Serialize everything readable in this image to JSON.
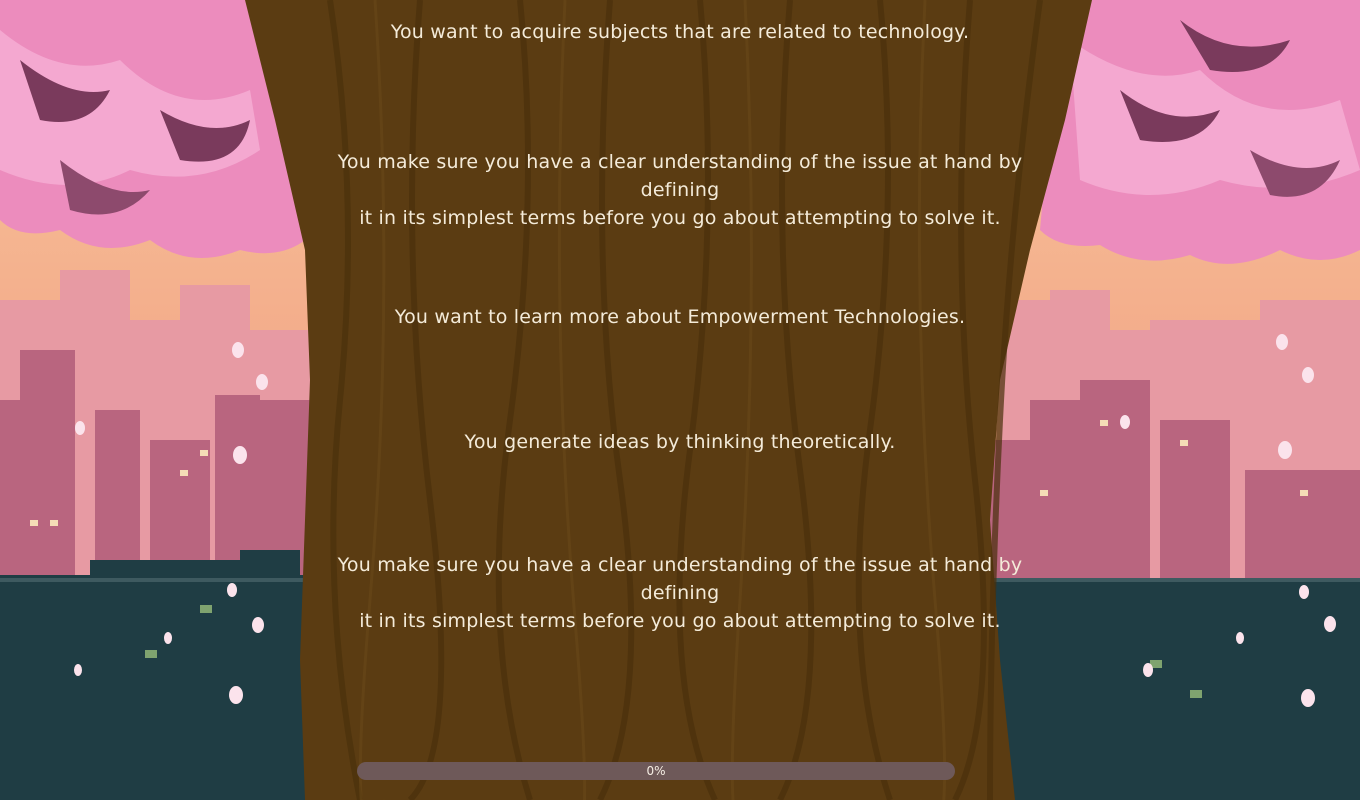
{
  "theme": {
    "sky": "#f6b98e",
    "blossom": "#ef8fc0",
    "blossom_dark": "#7a3a5c",
    "trunk": "#5a3b12",
    "text": "#f4ebd9",
    "progress_track": "#6e5959"
  },
  "quiz": {
    "statements": [
      {
        "text": "You want to acquire subjects that are related to technology."
      },
      {
        "text_line1": "You make sure you have a clear understanding of the issue at hand by defining",
        "text_line2": "it in its simplest terms before you go about attempting to solve it."
      },
      {
        "text": "You want to learn more about Empowerment Technologies."
      },
      {
        "text": "You generate ideas by thinking theoretically."
      },
      {
        "text_line1": "You make sure you have a clear understanding of the issue at hand by defining",
        "text_line2": "it in its simplest terms before you go about attempting to solve it."
      }
    ]
  },
  "progress": {
    "value": 0,
    "label": "0%"
  }
}
